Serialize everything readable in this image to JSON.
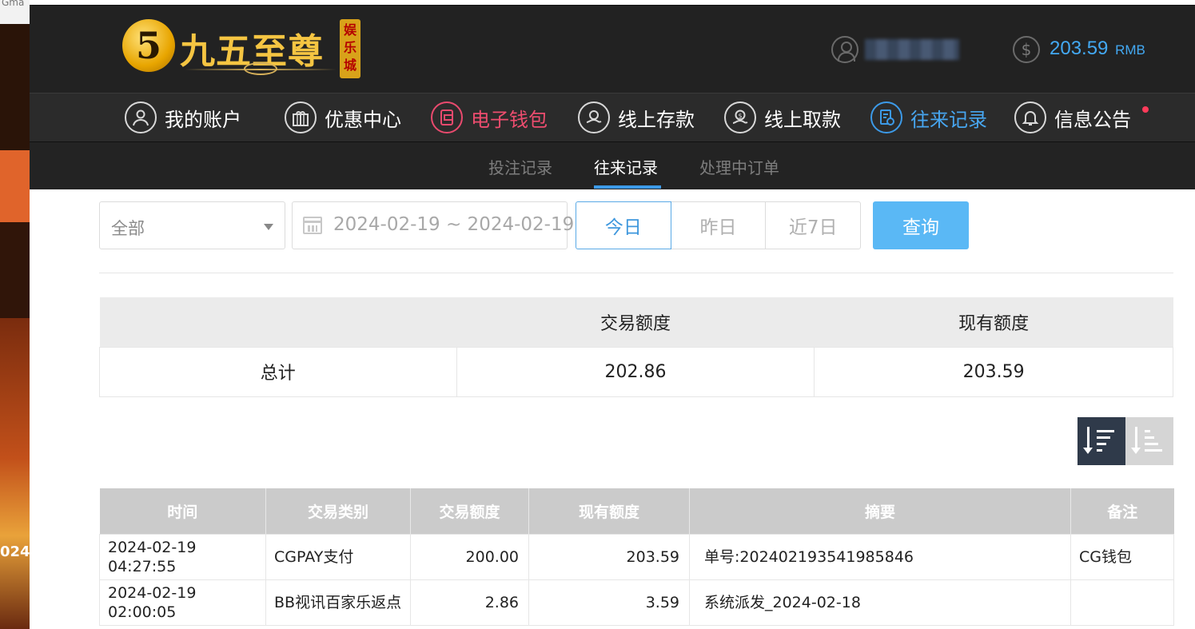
{
  "page": {
    "background_fragment": "Gma",
    "left_banner_text": "024/"
  },
  "header": {
    "logo_main": "九五至尊",
    "logo_side": "娱乐城",
    "user_icon": "user-icon",
    "balance_amount": "203.59",
    "balance_unit": "RMB",
    "accent_color": "#43a9f3"
  },
  "mainnav": {
    "items": [
      {
        "label": "我的账户",
        "icon": "user-icon"
      },
      {
        "label": "优惠中心",
        "icon": "gift-icon"
      },
      {
        "label": "电子钱包",
        "icon": "wallet-icon"
      },
      {
        "label": "线上存款",
        "icon": "deposit-icon"
      },
      {
        "label": "线上取款",
        "icon": "withdraw-icon"
      },
      {
        "label": "往来记录",
        "icon": "records-icon"
      },
      {
        "label": "信息公告",
        "icon": "bell-icon"
      }
    ],
    "active_red_index": 2,
    "active_blue_index": 5
  },
  "subnav": {
    "items": [
      "投注记录",
      "往来记录",
      "处理中订单"
    ],
    "active_index": 1
  },
  "filters": {
    "type_selected": "全部",
    "date_range": "2024-02-19 ~ 2024-02-19",
    "range_buttons": [
      "今日",
      "昨日",
      "近7日"
    ],
    "active_range_index": 0,
    "query_label": "查询"
  },
  "summary": {
    "headers": [
      "",
      "交易额度",
      "现有额度"
    ],
    "row_label": "总计",
    "transaction_total": "202.86",
    "current_total": "203.59"
  },
  "sort": {
    "desc_icon": "sort-desc-icon",
    "asc_icon": "sort-asc-icon"
  },
  "records": {
    "headers": [
      "时间",
      "交易类别",
      "交易额度",
      "现有额度",
      "摘要",
      "备注"
    ],
    "rows": [
      [
        "2024-02-19 04:27:55",
        "CGPAY支付",
        "200.00",
        "203.59",
        "单号:202402193541985846",
        "CG钱包"
      ],
      [
        "2024-02-19 02:00:05",
        "BB视讯百家乐返点",
        "2.86",
        "3.59",
        "系统派发_2024-02-18",
        ""
      ]
    ]
  }
}
